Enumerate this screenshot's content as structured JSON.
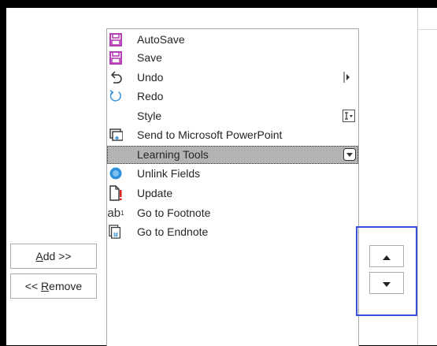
{
  "commands": [
    {
      "label": "AutoSave",
      "icon": "autosave-icon"
    },
    {
      "label": "Save",
      "icon": "save-icon"
    },
    {
      "label": "Undo",
      "icon": "undo-icon",
      "trailing": "expand-arrow-icon"
    },
    {
      "label": "Redo",
      "icon": "redo-icon"
    },
    {
      "label": "Style",
      "icon": "",
      "trailing": "style-dropdown-icon"
    },
    {
      "label": "Send to Microsoft PowerPoint",
      "icon": "powerpoint-send-icon"
    },
    {
      "label": "Learning Tools",
      "icon": "",
      "trailing": "dropdown-icon",
      "selected": true
    },
    {
      "label": "Unlink Fields",
      "icon": "unlink-fields-icon"
    },
    {
      "label": "Update",
      "icon": "update-icon"
    },
    {
      "label": "Go to Footnote",
      "icon": "footnote-icon"
    },
    {
      "label": "Go to Endnote",
      "icon": "endnote-icon"
    }
  ],
  "buttons": {
    "add": "Add >>",
    "remove": "<< Remove"
  },
  "colors": {
    "save_icon": "#b53fb5",
    "redo_icon": "#2f8fd8",
    "unlink_icon": "#2f8fd8",
    "update_mark": "#e02020",
    "highlight": "#3a4fd8",
    "selected_row": "#b3b3b3"
  }
}
